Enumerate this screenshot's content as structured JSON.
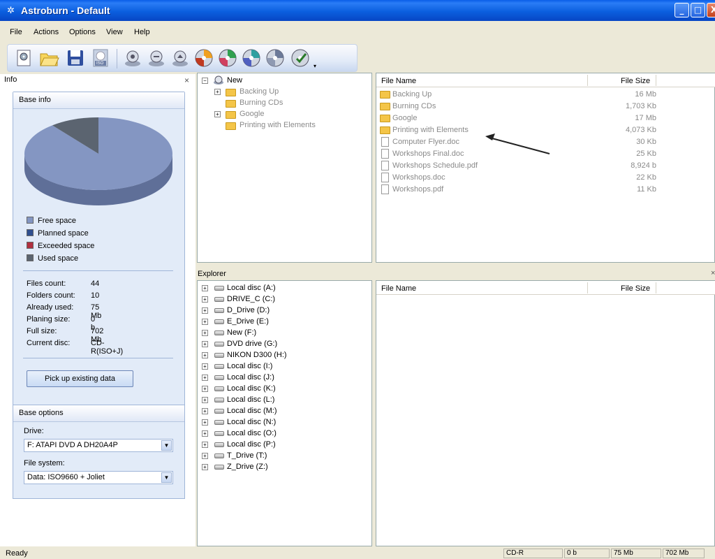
{
  "window": {
    "title": "Astroburn - Default",
    "min": "_",
    "max": "□",
    "close": "X"
  },
  "menu": [
    "File",
    "Actions",
    "Options",
    "View",
    "Help"
  ],
  "toolbar": {
    "iso_label": "ISO"
  },
  "info_panel": {
    "title": "Info",
    "close": "×",
    "base_info_header": "Base info",
    "chart_data": {
      "type": "pie",
      "categories": [
        "Free space",
        "Planned space",
        "Exceeded space",
        "Used space"
      ],
      "values": [
        89.3,
        0,
        0,
        10.7
      ],
      "colors": [
        "#8496c2",
        "#2f4f8f",
        "#b03040",
        "#5b6470"
      ]
    },
    "legend": [
      {
        "label": "Free space",
        "color": "#8496c2"
      },
      {
        "label": "Planned space",
        "color": "#2f4f8f"
      },
      {
        "label": "Exceeded space",
        "color": "#b03040"
      },
      {
        "label": "Used space",
        "color": "#5b6470"
      }
    ],
    "stats": [
      {
        "label": "Files count:",
        "value": "44"
      },
      {
        "label": "Folders count:",
        "value": "10"
      },
      {
        "label": "Already used:",
        "value": "75 Mb"
      },
      {
        "label": "Planing size:",
        "value": "0 b"
      },
      {
        "label": "Full size:",
        "value": "702 Mb"
      },
      {
        "label": "Current disc:",
        "value": "CD-R(ISO+J)"
      }
    ],
    "pick_button": "Pick up existing data",
    "base_options_header": "Base options",
    "drive_label": "Drive:",
    "drive_value": "F: ATAPI  DVD A  DH20A4P",
    "fs_label": "File system:",
    "fs_value": "Data: ISO9660 + Joliet"
  },
  "project_tree": {
    "root": "New",
    "items": [
      {
        "label": "Backing Up",
        "expandable": true
      },
      {
        "label": "Burning CDs",
        "expandable": false
      },
      {
        "label": "Google",
        "expandable": true
      },
      {
        "label": "Printing with Elements",
        "expandable": false
      }
    ]
  },
  "project_list": {
    "col_name": "File Name",
    "col_size": "File Size",
    "rows": [
      {
        "name": "Backing Up",
        "size": "16 Mb",
        "type": "folder"
      },
      {
        "name": "Burning CDs",
        "size": "1,703 Kb",
        "type": "folder"
      },
      {
        "name": "Google",
        "size": "17 Mb",
        "type": "folder"
      },
      {
        "name": "Printing with Elements",
        "size": "4,073 Kb",
        "type": "folder"
      },
      {
        "name": "Computer Flyer.doc",
        "size": "30 Kb",
        "type": "file"
      },
      {
        "name": "Workshops Final.doc",
        "size": "25 Kb",
        "type": "file"
      },
      {
        "name": "Workshops Schedule.pdf",
        "size": "8,924 b",
        "type": "file"
      },
      {
        "name": "Workshops.doc",
        "size": "22 Kb",
        "type": "file"
      },
      {
        "name": "Workshops.pdf",
        "size": "11 Kb",
        "type": "file"
      }
    ]
  },
  "explorer": {
    "title": "Explorer",
    "close": "×",
    "col_name": "File Name",
    "col_size": "File Size",
    "drives": [
      "Local disc (A:)",
      "DRIVE_C (C:)",
      "D_Drive (D:)",
      "E_Drive (E:)",
      "New (F:)",
      "DVD drive (G:)",
      "NIKON D300 (H:)",
      "Local disc (I:)",
      "Local disc (J:)",
      "Local disc (K:)",
      "Local disc (L:)",
      "Local disc (M:)",
      "Local disc (N:)",
      "Local disc (O:)",
      "Local disc (P:)",
      "T_Drive (T:)",
      "Z_Drive (Z:)"
    ]
  },
  "statusbar": {
    "text": "Ready",
    "disc": "CD-R",
    "planned": "0 b",
    "used": "75 Mb",
    "total": "702 Mb"
  }
}
